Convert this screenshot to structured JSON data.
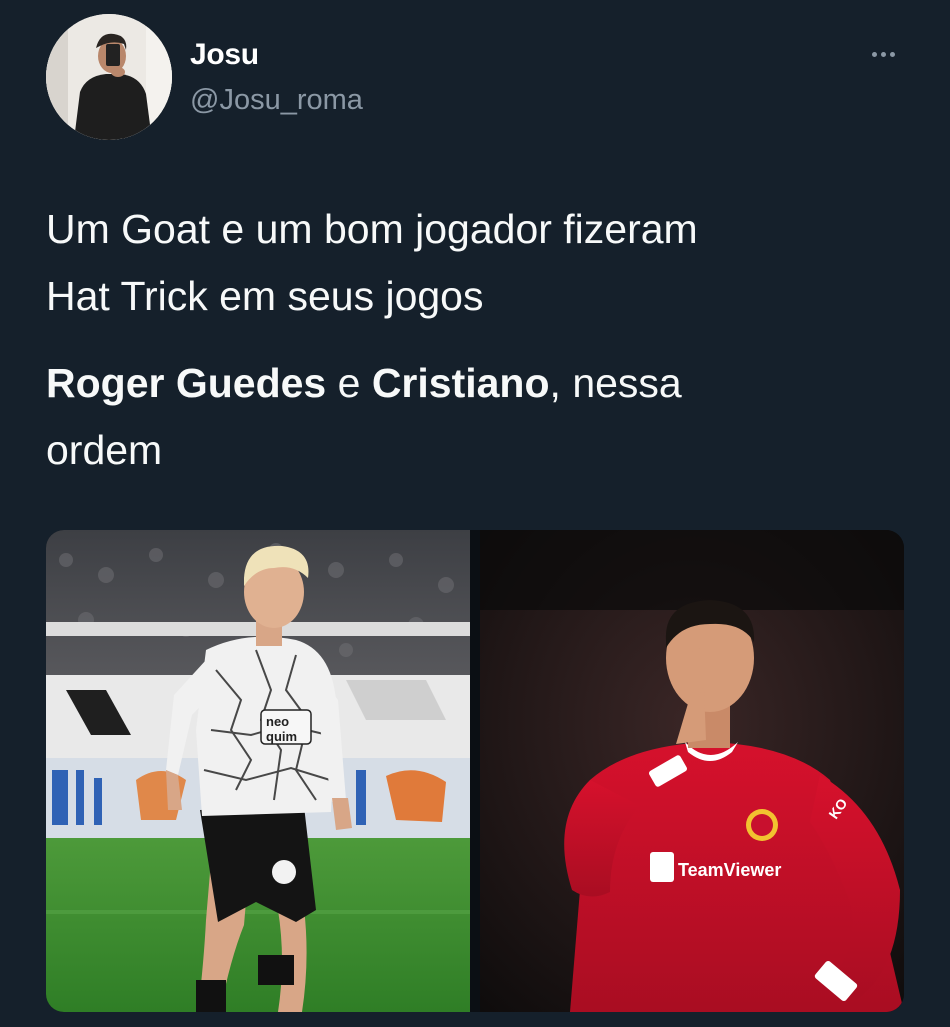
{
  "tweet": {
    "author": {
      "display_name": "Josu",
      "handle": "@Josu_roma"
    },
    "text": {
      "line1": "Um Goat e um bom jogador fizeram",
      "line2": "Hat Trick em seus jogos",
      "name1": "Roger Guedes",
      "connector": " e ",
      "name2": "Cristiano",
      "tail": ", nessa",
      "line4": "ordem"
    },
    "media": {
      "left_jersey_text_1": "neo",
      "left_jersey_text_2": "quim",
      "right_sponsor": "TeamViewer",
      "right_sleeve": "KO"
    }
  },
  "colors": {
    "background": "#15202b",
    "text": "#f7f9f9",
    "secondary": "#8b98a5",
    "united_red": "#c8102e"
  },
  "icons": [
    "more-icon"
  ]
}
